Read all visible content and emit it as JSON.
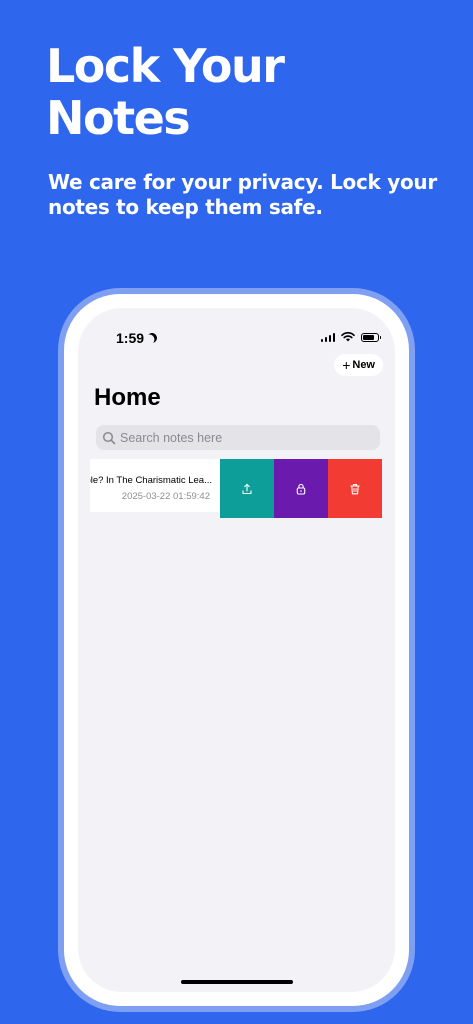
{
  "promo": {
    "headline_line1": "Lock Your",
    "headline_line2": "Notes",
    "subtitle": "We care for your privacy. Lock your notes to keep them safe."
  },
  "status_bar": {
    "time": "1:59"
  },
  "header": {
    "new_button_label": "New",
    "title": "Home"
  },
  "search": {
    "placeholder": "Search notes here"
  },
  "notes": [
    {
      "title": "ple? In The Charismatic Lea...",
      "date": "2025-03-22 01:59:42"
    }
  ],
  "swipe_actions": {
    "share_icon": "share-icon",
    "lock_icon": "lock-icon",
    "delete_icon": "trash-icon"
  },
  "colors": {
    "background": "#2E66EE",
    "share": "#0E9E9A",
    "lock": "#6A1BAE",
    "delete": "#F23B32"
  }
}
